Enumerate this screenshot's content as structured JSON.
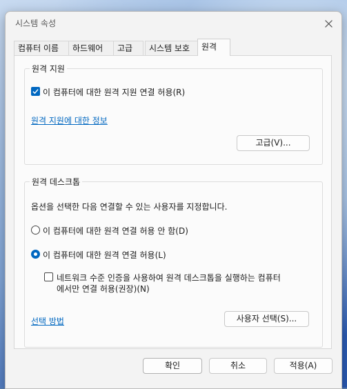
{
  "window": {
    "title": "시스템 속성"
  },
  "tabs": [
    {
      "label": "컴퓨터 이름"
    },
    {
      "label": "하드웨어"
    },
    {
      "label": "고급"
    },
    {
      "label": "시스템 보호"
    },
    {
      "label": "원격"
    }
  ],
  "active_tab": "원격",
  "remote_assistance": {
    "group_label": "원격 지원",
    "allow_checkbox_label": "이 컴퓨터에 대한 원격 지원 연결 허용(R)",
    "allow_checked": true,
    "info_link": "원격 지원에 대한 정보",
    "advanced_button": "고급(V)..."
  },
  "remote_desktop": {
    "group_label": "원격 데스크톱",
    "description": "옵션을 선택한 다음 연결할 수 있는 사용자를 지정합니다.",
    "option_disallow": "이 컴퓨터에 대한 원격 연결 허용 안 함(D)",
    "option_allow": "이 컴퓨터에 대한 원격 연결 허용(L)",
    "selected_option": "allow",
    "nla_line1": "네트워크 수준 인증을 사용하여 원격 데스크톱을 실행하는 컴퓨터",
    "nla_line2": "에서만 연결 허용(권장)(N)",
    "nla_checked": false,
    "help_link": "선택 방법",
    "select_users_button": "사용자 선택(S)..."
  },
  "footer": {
    "ok": "확인",
    "cancel": "취소",
    "apply": "적용(A)"
  },
  "colors": {
    "accent": "#0067c0"
  }
}
